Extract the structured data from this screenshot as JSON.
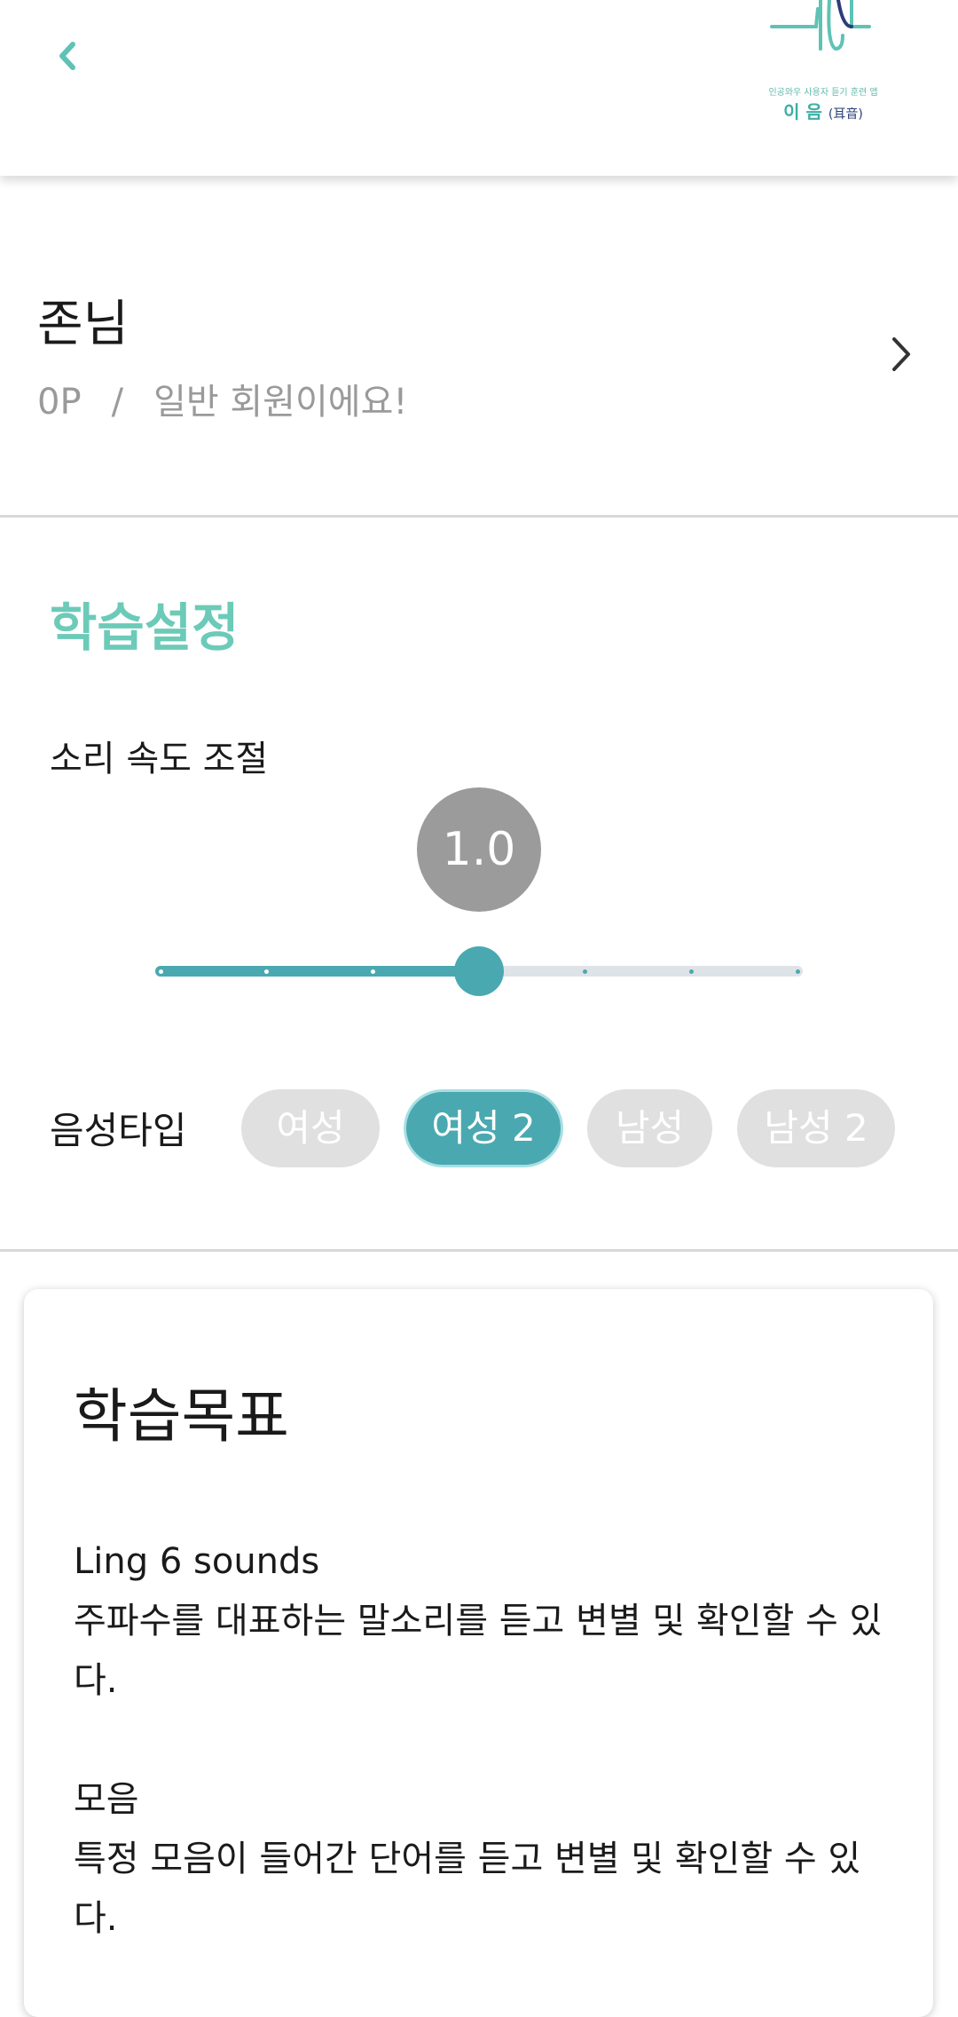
{
  "header": {
    "back_icon": "chevron-left-icon",
    "logo_small_text": "인공와우 사용자 듣기 훈련 앱",
    "logo_name": "이 음",
    "logo_paren": "(耳音)"
  },
  "profile": {
    "name": "존님",
    "points": "0P",
    "separator": "/",
    "status": "일반 회원이에요!"
  },
  "settings": {
    "title": "학습설정",
    "speed_label": "소리 속도 조절",
    "speed_value": "1.0",
    "speed_steps": 7,
    "speed_index": 3,
    "voice_label": "음성타입",
    "voice_options": [
      "여성",
      "여성 2",
      "남성",
      "남성 2"
    ],
    "voice_selected": "여성 2"
  },
  "goals": {
    "title": "학습목표",
    "items": [
      {
        "heading": "Ling 6 sounds",
        "text": "주파수를 대표하는 말소리를 듣고 변별 및 확인할 수 있다."
      },
      {
        "heading": "모음",
        "text": "특정 모음이 들어간 단어를 듣고 변별 및 확인할 수 있다."
      }
    ]
  },
  "colors": {
    "accent": "#4aa9b0",
    "title_green": "#6ccab8",
    "inactive": "#e0e0e0"
  }
}
